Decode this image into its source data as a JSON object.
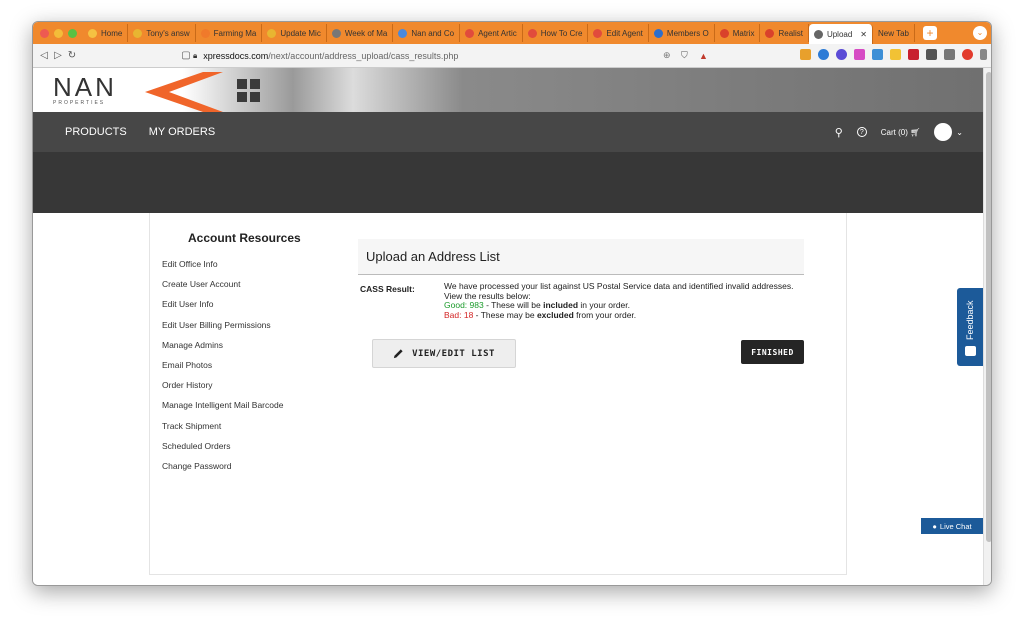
{
  "browser": {
    "tabs": [
      {
        "label": "Home",
        "color": "#f5c242"
      },
      {
        "label": "Tony's answ",
        "color": "#e8b531"
      },
      {
        "label": "Farming Ma",
        "color": "#f07a2b"
      },
      {
        "label": "Update Mic",
        "color": "#e8b531"
      },
      {
        "label": "Week of Ma",
        "color": "#777777"
      },
      {
        "label": "Nan and Co",
        "color": "#4a89dc"
      },
      {
        "label": "Agent Artic",
        "color": "#e14b3c"
      },
      {
        "label": "How To Cre",
        "color": "#e14b3c"
      },
      {
        "label": "Edit Agent",
        "color": "#e14b3c"
      },
      {
        "label": "Members O",
        "color": "#2d6ecb"
      },
      {
        "label": "Matrix",
        "color": "#d9412b"
      },
      {
        "label": "Realist",
        "color": "#d9412b"
      },
      {
        "label": "Upload",
        "color": "#666666",
        "active": true
      },
      {
        "label": "New Tab",
        "color": "#f0892d"
      }
    ],
    "url_domain": "xpressdocs.com",
    "url_path": "/next/account/address_upload/cass_results.php"
  },
  "header": {
    "logo_text": "NAN",
    "logo_sub": "PROPERTIES",
    "menu": {
      "products": "PRODUCTS",
      "my_orders": "MY ORDERS",
      "cart": "Cart (0)"
    }
  },
  "sidebar": {
    "title": "Account Resources",
    "items": [
      "Edit Office Info",
      "Create User Account",
      "Edit User Info",
      "Edit User Billing Permissions",
      "Manage Admins",
      "Email Photos",
      "Order History",
      "Manage Intelligent Mail Barcode",
      "Track Shipment",
      "Scheduled Orders",
      "Change Password"
    ]
  },
  "main": {
    "panel_title": "Upload an Address List",
    "cass_label": "CASS Result:",
    "message": "We have processed your list against US Postal Service data and identified invalid addresses. View the results below:",
    "good_label": "Good: 983",
    "good_mid": " - These will be ",
    "good_strong": "included",
    "good_tail": " in your order.",
    "bad_label": "Bad: 18",
    "bad_mid": " - These may be ",
    "bad_strong": "excluded",
    "bad_tail": " from your order.",
    "view_button": "VIEW/EDIT LIST",
    "finished_button": "FINISHED"
  },
  "widgets": {
    "feedback": "Feedback",
    "live_chat": "Live Chat"
  },
  "colors": {
    "tab_strip": "#f0892d",
    "menu_bar": "#474747",
    "good": "#1a9b2a",
    "bad": "#d32424",
    "feedback": "#1c5a99"
  }
}
